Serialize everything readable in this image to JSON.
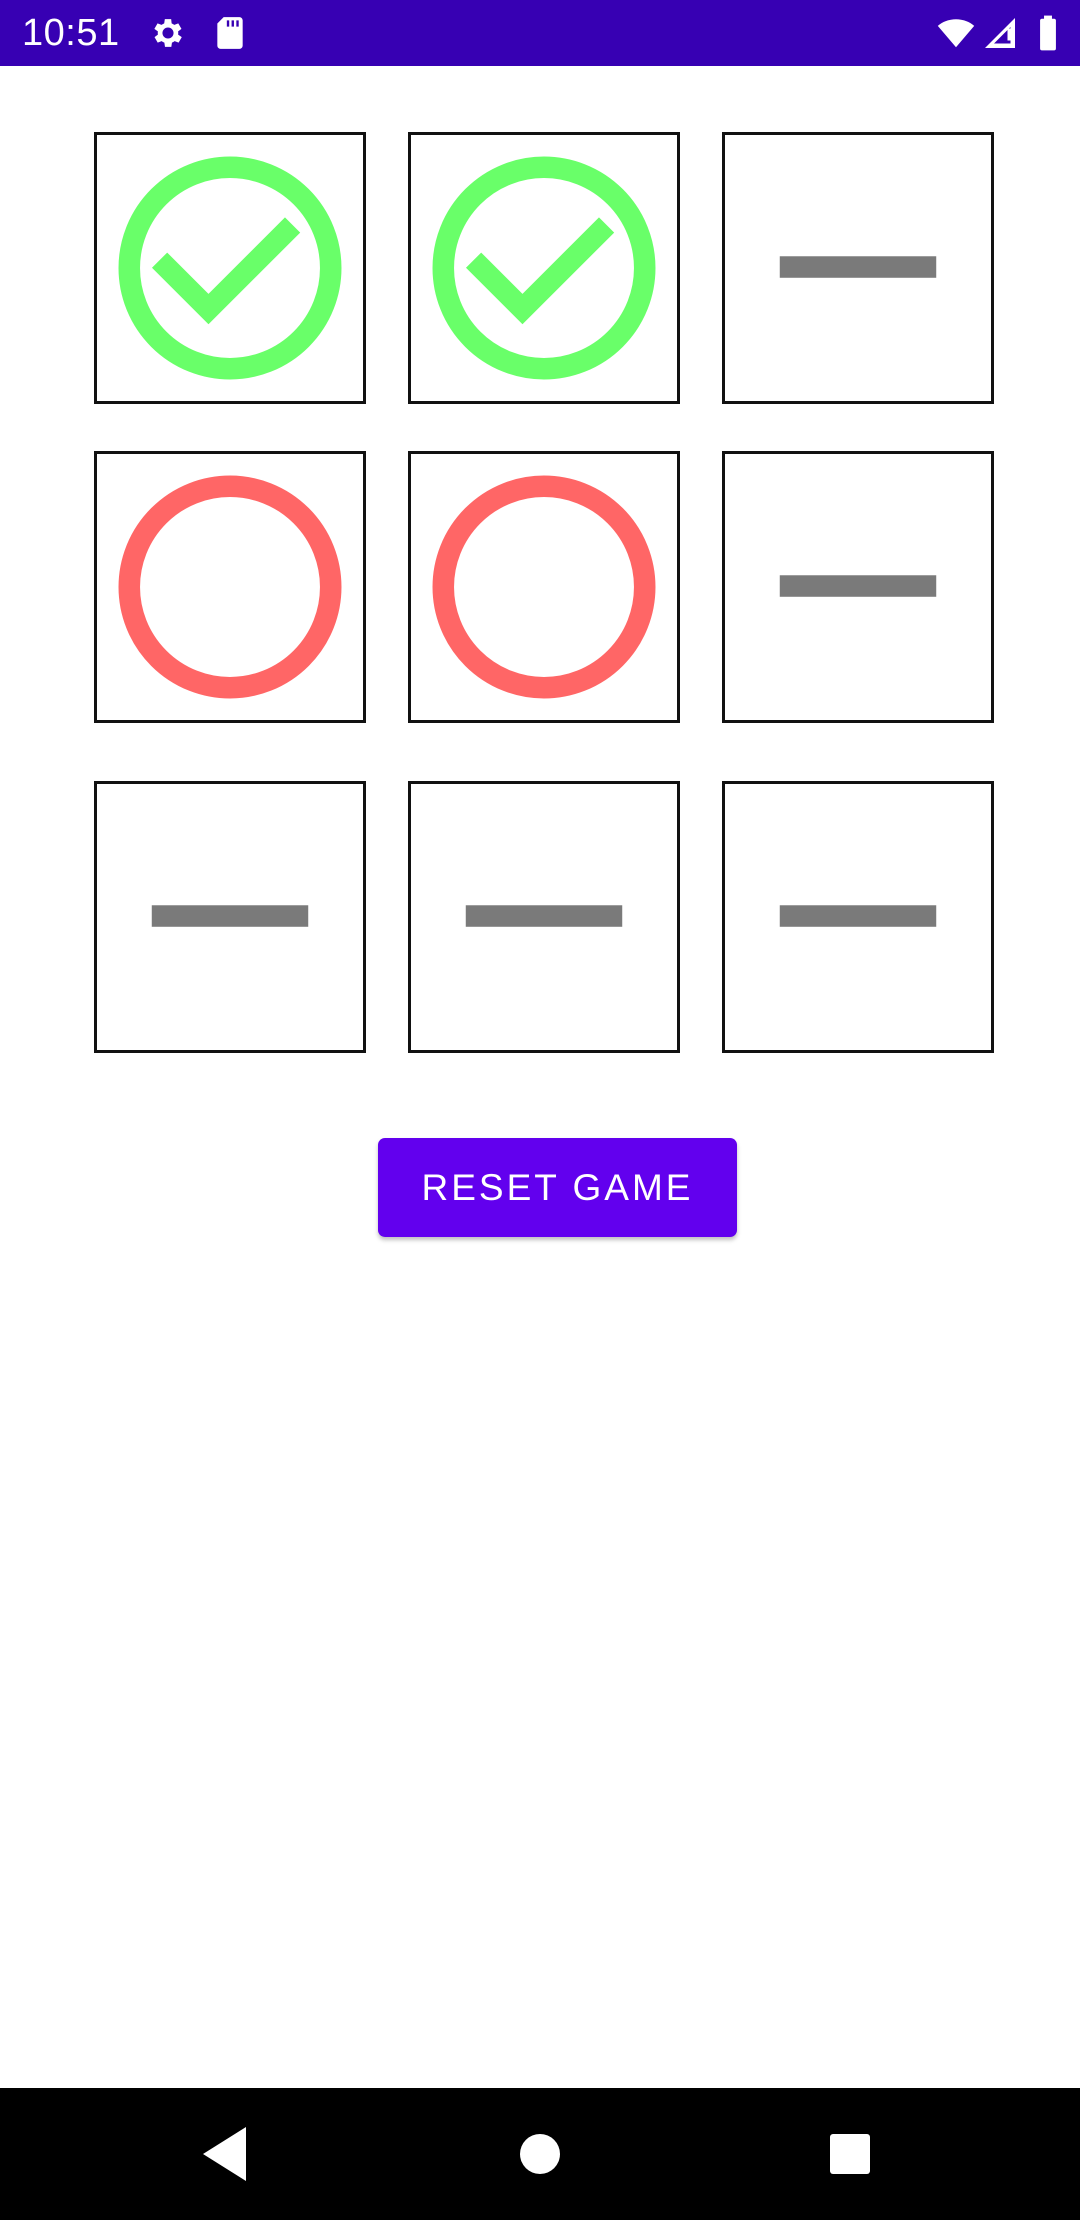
{
  "status_bar": {
    "time": "10:51",
    "icons": [
      "settings-icon",
      "sd-card-icon",
      "wifi-icon",
      "cell-signal-icon",
      "battery-icon"
    ],
    "background": "#3700b3"
  },
  "board": {
    "cells": [
      [
        "check",
        "check",
        "empty"
      ],
      [
        "circle",
        "circle",
        "empty"
      ],
      [
        "empty",
        "empty",
        "empty"
      ]
    ],
    "colors": {
      "check": "#69ff69",
      "circle": "#ff6666",
      "empty": "#7a7a7a"
    }
  },
  "reset_button": {
    "label": "RESET GAME",
    "color": "#6200ee"
  },
  "nav_bar": {
    "icons": [
      "back-icon",
      "home-icon",
      "recents-icon"
    ]
  }
}
